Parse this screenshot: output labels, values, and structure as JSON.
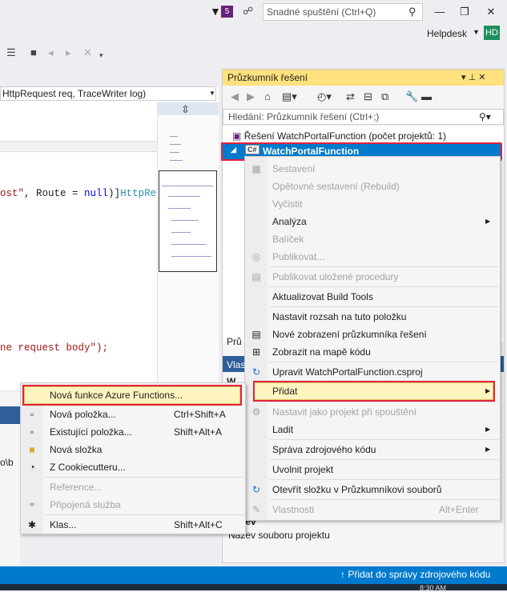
{
  "titlebar": {
    "notif_count": "5",
    "quick_launch_placeholder": "Snadné spuštění (Ctrl+Q)",
    "minimize_glyph": "—",
    "restore_glyph": "❐",
    "close_glyph": "✕",
    "user_name": "Helpdesk",
    "user_initials": "HD"
  },
  "editor": {
    "signature": "HttpRequest req, TraceWriter log)",
    "code_line_1": {
      "str": "ost\"",
      "mid": ", Route = ",
      "kw": "null",
      "end": ")]",
      "type": "HttpReque"
    },
    "code_line_2": "ne request body\");",
    "left_panel_text": "o\\b"
  },
  "solution_explorer": {
    "title": "Průzkumník řešení",
    "search_placeholder": "Hledání: Průzkumník řešení (Ctrl+;)",
    "solution_label": "Řešení WatchPortalFunction (počet projektů: 1)",
    "project_label": "WatchPortalFunction",
    "bottom_label": "Prů"
  },
  "properties": {
    "header": "Vlas",
    "w_label": "W",
    "name_label": "Název",
    "name_desc": "Název souboru projektu"
  },
  "context_menu": {
    "items": [
      {
        "label": "Sestavení",
        "disabled": true
      },
      {
        "label": "Opětovné sestavení (Rebuild)",
        "disabled": true
      },
      {
        "label": "Vyčistit",
        "disabled": true
      },
      {
        "label": "Analýza",
        "disabled": false,
        "submenu": true
      },
      {
        "label": "Balíček",
        "disabled": true
      },
      {
        "label": "Publikovat...",
        "disabled": true
      },
      {
        "label": "Publikovat uložené procedury",
        "disabled": true
      },
      {
        "label": "Aktualizovat Build Tools",
        "disabled": false
      },
      {
        "label": "Nastavit rozsah na tuto položku",
        "disabled": false
      },
      {
        "label": "Nové zobrazení průzkumníka řešení",
        "disabled": false
      },
      {
        "label": "Zobrazit na mapě kódu",
        "disabled": false
      },
      {
        "label": "Upravit WatchPortalFunction.csproj",
        "disabled": false
      },
      {
        "label": "Přidat",
        "disabled": false,
        "submenu": true
      },
      {
        "label": "Nastavit jako projekt při spouštění",
        "disabled": true
      },
      {
        "label": "Ladit",
        "disabled": false,
        "submenu": true
      },
      {
        "label": "Správa zdrojového kódu",
        "disabled": false,
        "submenu": true
      },
      {
        "label": "Uvolnit projekt",
        "disabled": false
      },
      {
        "label": "Otevřít složku v Průzkumníkovi souborů",
        "disabled": false
      },
      {
        "label": "Vlastnosti",
        "disabled": true,
        "shortcut": "Alt+Enter"
      }
    ]
  },
  "add_submenu": {
    "items": [
      {
        "label": "Nová funkce Azure Functions...",
        "disabled": false
      },
      {
        "label": "Nová položka...",
        "shortcut": "Ctrl+Shift+A",
        "disabled": false
      },
      {
        "label": "Existující položka...",
        "shortcut": "Shift+Alt+A",
        "disabled": false
      },
      {
        "label": "Nová složka",
        "disabled": false
      },
      {
        "label": "Z Cookiecutteru...",
        "disabled": false
      },
      {
        "label": "Reference...",
        "disabled": true
      },
      {
        "label": "Připojená služba",
        "disabled": true
      },
      {
        "label": "Klas...",
        "shortcut": "Shift+Alt+C",
        "disabled": false
      }
    ]
  },
  "statusbar": {
    "source_control": "↑ Přidat do správy zdrojového kódu",
    "clock": "8:30 AM"
  }
}
